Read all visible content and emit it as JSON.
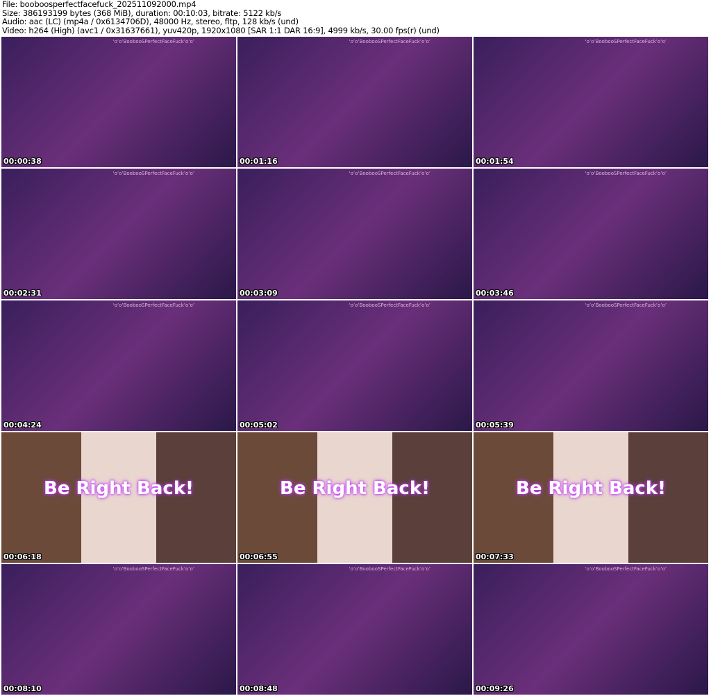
{
  "header": {
    "file": "File: booboosperfectfacefuck_202511092000.mp4",
    "size": "Size: 386193199 bytes (368 MiB), duration: 00:10:03, bitrate: 5122 kb/s",
    "audio": "Audio: aac (LC) (mp4a / 0x6134706D), 48000 Hz, stereo, fltp, 128 kb/s (und)",
    "video": "Video: h264 (High) (avc1 / 0x31637661), yuv420p, 1920x1080 [SAR 1:1 DAR 16:9], 4999 kb/s, 30.00 fps(r) (und)"
  },
  "watermark": "‘o’o’BoobooSPerfectFaceFuck’o’o’",
  "brb_text": "Be Right Back!",
  "thumbnails": [
    {
      "time": "00:00:38",
      "brb": false
    },
    {
      "time": "00:01:16",
      "brb": false
    },
    {
      "time": "00:01:54",
      "brb": false
    },
    {
      "time": "00:02:31",
      "brb": false
    },
    {
      "time": "00:03:09",
      "brb": false
    },
    {
      "time": "00:03:46",
      "brb": false
    },
    {
      "time": "00:04:24",
      "brb": false
    },
    {
      "time": "00:05:02",
      "brb": false
    },
    {
      "time": "00:05:39",
      "brb": false
    },
    {
      "time": "00:06:18",
      "brb": true
    },
    {
      "time": "00:06:55",
      "brb": true
    },
    {
      "time": "00:07:33",
      "brb": true
    },
    {
      "time": "00:08:10",
      "brb": false
    },
    {
      "time": "00:08:48",
      "brb": false
    },
    {
      "time": "00:09:26",
      "brb": false
    }
  ]
}
